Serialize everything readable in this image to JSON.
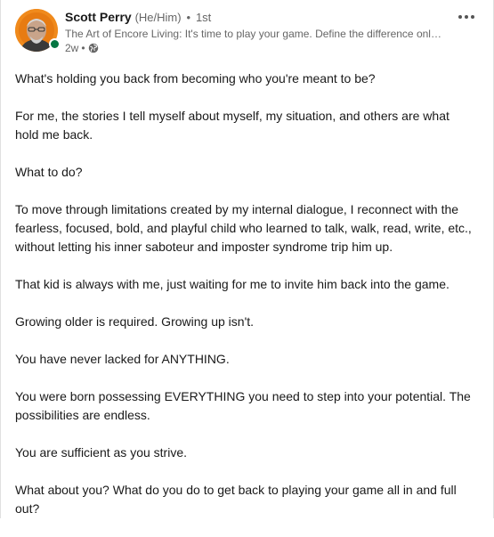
{
  "author": {
    "name": "Scott Perry",
    "pronouns": "(He/Him)",
    "degree": "1st",
    "headline": "The Art of Encore Living: It's time to play your game. Define the difference only ...",
    "time_ago": "2w",
    "online_status_color": "#057642"
  },
  "post": {
    "paragraphs": [
      "What's holding you back from becoming who you're meant to be?",
      "For me, the stories I tell myself about myself, my situation, and others are what hold me back.",
      "What to do?",
      "To move through limitations created by my internal dialogue, I reconnect with the fearless, focused, bold, and playful child who learned to talk, walk, read, write, etc., without letting his inner saboteur and imposter syndrome trip him up.",
      "That kid is always with me, just waiting for me to invite him back into the game.",
      "Growing older is required. Growing up isn't.",
      "You have never lacked for ANYTHING.",
      "You were born possessing EVERYTHING you need to step into your potential. The possibilities are endless.",
      "You are sufficient as you strive.",
      "What about you? What do you do to get back to playing your game all in and full out?"
    ]
  },
  "icons": {
    "visibility": "globe-icon",
    "menu": "more-options-icon"
  }
}
